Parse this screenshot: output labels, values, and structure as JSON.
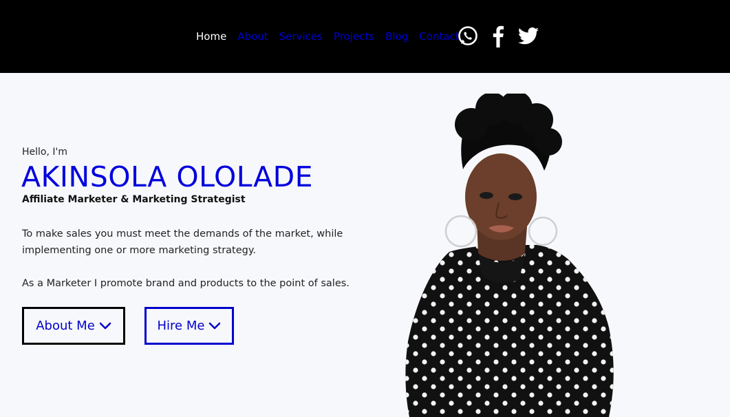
{
  "nav": {
    "links": [
      {
        "label": "Home"
      },
      {
        "label": "About"
      },
      {
        "label": "Services"
      },
      {
        "label": "Projects"
      },
      {
        "label": "Blog"
      },
      {
        "label": "Contact"
      }
    ],
    "active_color": "#ffffff",
    "link_color": "#0000cc",
    "social_icons": [
      "whatsapp-icon",
      "facebook-icon",
      "twitter-icon"
    ]
  },
  "hero": {
    "greeting": "Hello, I'm",
    "name": "AKINSOLA OLOLADE",
    "role": "Affiliate Marketer & Marketing Strategist",
    "paragraph1": "To make sales you must meet the demands of the market, while implementing one or more marketing strategy.",
    "paragraph2": "As a Marketer I promote brand and products to the point of sales.",
    "buttons": {
      "about_label": "About Me",
      "hire_label": "Hire Me"
    },
    "accent_color": "#0000dd"
  }
}
